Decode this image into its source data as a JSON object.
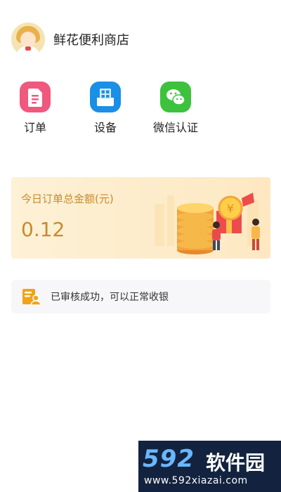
{
  "header": {
    "shop_name": "鲜花便利商店"
  },
  "menu": [
    {
      "label": "订单",
      "icon": "document-icon",
      "color": "#f0587e"
    },
    {
      "label": "设备",
      "icon": "device-icon",
      "color": "#1a8fe6"
    },
    {
      "label": "微信认证",
      "icon": "wechat-icon",
      "color": "#3cc23c"
    }
  ],
  "banner": {
    "title": "今日订单总金额(元)",
    "amount": "0.12",
    "accent_color": "#c98a2c"
  },
  "notice": {
    "text": "已审核成功，可以正常收银",
    "icon": "id-card-icon",
    "icon_color": "#f0a31a"
  },
  "watermark": {
    "logo": "592",
    "brand": "软件园",
    "url": "www.592xiazai.com"
  }
}
